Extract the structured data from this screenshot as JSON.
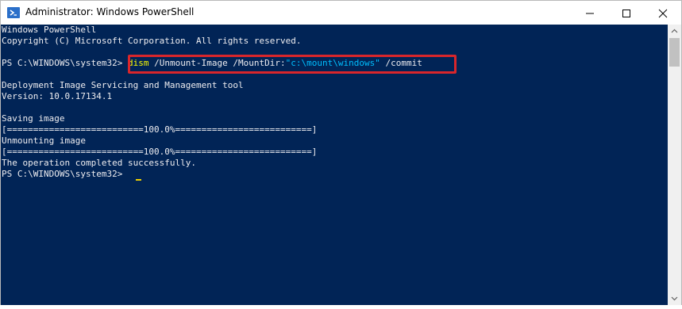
{
  "window": {
    "title": "Administrator: Windows PowerShell",
    "controls": {
      "minimize": "minimize-icon",
      "maximize": "maximize-icon",
      "close": "close-icon"
    }
  },
  "console": {
    "background": "#012456",
    "text_color": "#eeedf0",
    "command_color": "#ffff00",
    "string_color": "#00bfff",
    "highlight_color": "#d9262b",
    "header_line1": "Windows PowerShell",
    "header_line2": "Copyright (C) Microsoft Corporation. All rights reserved.",
    "prompt": "PS C:\\WINDOWS\\system32> ",
    "command": {
      "exe": "dism",
      "args_before": " /Unmount-Image /MountDir:",
      "string_arg": "\"c:\\mount\\windows\"",
      "args_after": " /commit"
    },
    "tool_name": "Deployment Image Servicing and Management tool",
    "version": "Version: 10.0.17134.1",
    "saving": "Saving image",
    "progress_saving": "[==========================100.0%==========================]",
    "unmounting": "Unmounting image",
    "progress_unmounting": "[==========================100.0%==========================]",
    "success": "The operation completed successfully.",
    "final_prompt": "PS C:\\WINDOWS\\system32> "
  }
}
